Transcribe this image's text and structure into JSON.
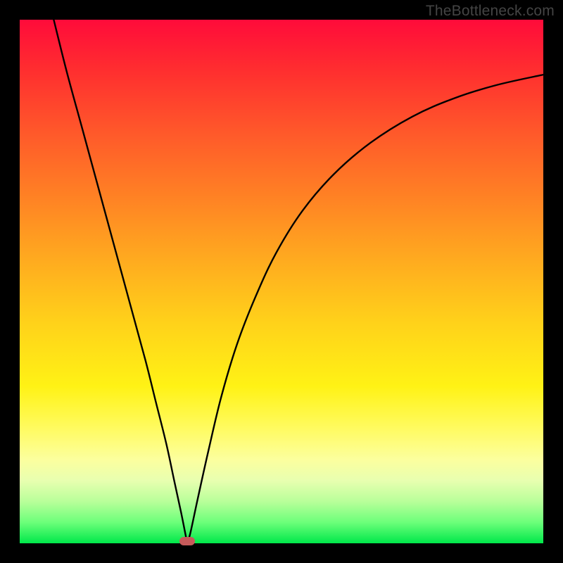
{
  "watermark": "TheBottleneck.com",
  "colors": {
    "curve_stroke": "#000000",
    "dot_fill": "#c65a5a"
  },
  "chart_data": {
    "type": "line",
    "title": "",
    "xlabel": "",
    "ylabel": "",
    "xlim": [
      0,
      1
    ],
    "ylim": [
      0,
      1
    ],
    "curve_points": [
      {
        "x": 0.065,
        "y": 1.0
      },
      {
        "x": 0.09,
        "y": 0.9
      },
      {
        "x": 0.12,
        "y": 0.79
      },
      {
        "x": 0.15,
        "y": 0.68
      },
      {
        "x": 0.18,
        "y": 0.57
      },
      {
        "x": 0.21,
        "y": 0.46
      },
      {
        "x": 0.24,
        "y": 0.35
      },
      {
        "x": 0.26,
        "y": 0.27
      },
      {
        "x": 0.28,
        "y": 0.19
      },
      {
        "x": 0.295,
        "y": 0.12
      },
      {
        "x": 0.308,
        "y": 0.06
      },
      {
        "x": 0.316,
        "y": 0.02
      },
      {
        "x": 0.32,
        "y": 0.0
      },
      {
        "x": 0.326,
        "y": 0.02
      },
      {
        "x": 0.34,
        "y": 0.085
      },
      {
        "x": 0.36,
        "y": 0.175
      },
      {
        "x": 0.385,
        "y": 0.28
      },
      {
        "x": 0.415,
        "y": 0.38
      },
      {
        "x": 0.45,
        "y": 0.47
      },
      {
        "x": 0.49,
        "y": 0.555
      },
      {
        "x": 0.54,
        "y": 0.635
      },
      {
        "x": 0.6,
        "y": 0.705
      },
      {
        "x": 0.67,
        "y": 0.765
      },
      {
        "x": 0.75,
        "y": 0.815
      },
      {
        "x": 0.83,
        "y": 0.85
      },
      {
        "x": 0.91,
        "y": 0.875
      },
      {
        "x": 1.0,
        "y": 0.895
      }
    ],
    "marker": {
      "x": 0.32,
      "y": 0.0
    }
  }
}
